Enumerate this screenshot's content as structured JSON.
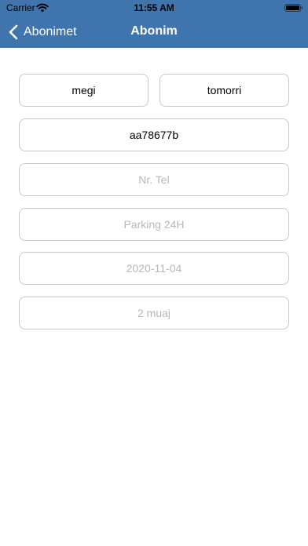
{
  "status_bar": {
    "carrier": "Carrier",
    "time": "11:55 AM"
  },
  "nav": {
    "back_label": "Abonimet",
    "title": "Abonim"
  },
  "form": {
    "first_name": {
      "value": "megi"
    },
    "last_name": {
      "value": "tomorri"
    },
    "plate": {
      "value": "aa78677b"
    },
    "phone": {
      "value": "",
      "placeholder": "Nr. Tel"
    },
    "parking": {
      "value": "",
      "placeholder": "Parking 24H"
    },
    "date": {
      "value": "",
      "placeholder": "2020-11-04"
    },
    "duration": {
      "value": "",
      "placeholder": "2 muaj"
    }
  },
  "colors": {
    "nav_background": "#3f74ad",
    "field_border": "#c8c8c8",
    "placeholder_text": "#b8b8b8"
  },
  "icons": {
    "back": "chevron-left-icon",
    "wifi": "wifi-icon",
    "battery": "battery-icon"
  }
}
